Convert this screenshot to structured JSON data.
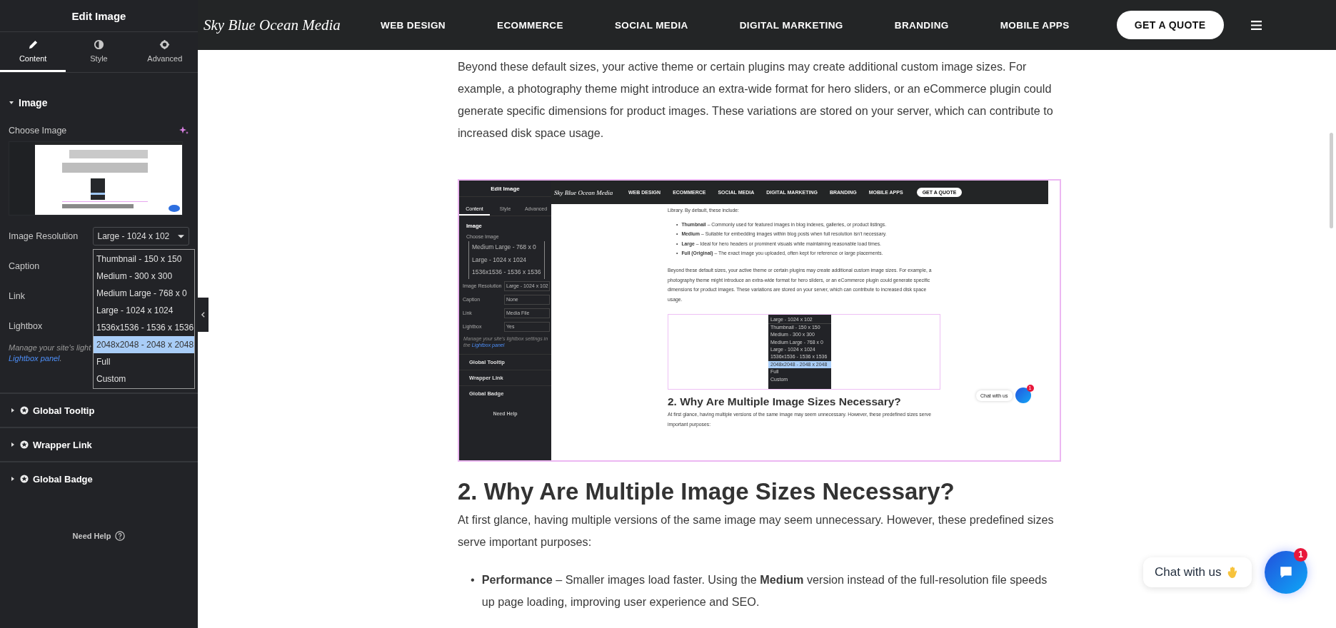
{
  "panel": {
    "title": "Edit Image",
    "tabs": [
      {
        "label": "Content",
        "selected": true
      },
      {
        "label": "Style",
        "selected": false
      },
      {
        "label": "Advanced",
        "selected": false
      }
    ],
    "section": {
      "title": "Image",
      "expanded": true
    },
    "choose_image": "Choose Image",
    "fields": [
      {
        "label": "Image Resolution",
        "value": "Large - 1024 x 102"
      },
      {
        "label": "Caption"
      },
      {
        "label": "Link"
      },
      {
        "label": "Lightbox"
      }
    ],
    "dropdown": [
      {
        "label": "Thumbnail - 150 x 150",
        "selected": false
      },
      {
        "label": "Medium - 300 x 300",
        "selected": false
      },
      {
        "label": "Medium Large - 768 x 0",
        "selected": false
      },
      {
        "label": "Large - 1024 x 1024",
        "selected": false
      },
      {
        "label": "1536x1536 - 1536 x 1536",
        "selected": false
      },
      {
        "label": "2048x2048 - 2048 x 2048",
        "selected": true
      },
      {
        "label": "Full",
        "selected": false
      },
      {
        "label": "Custom",
        "selected": false
      }
    ],
    "help": {
      "text": "Manage your site's light",
      "link": "Lightbox panel",
      "after": "."
    },
    "groups": [
      {
        "title": "Global Tooltip",
        "expanded": false
      },
      {
        "title": "Wrapper Link",
        "expanded": false
      },
      {
        "title": "Global Badge",
        "expanded": false
      }
    ],
    "need_help": "Need Help"
  },
  "navbar": {
    "logo": "Sky Blue Ocean Media",
    "links": [
      "WEB DESIGN",
      "ECOMMERCE",
      "SOCIAL MEDIA",
      "DIGITAL MARKETING",
      "BRANDING",
      "MOBILE APPS"
    ],
    "cta": "GET A QUOTE"
  },
  "article": {
    "intro": "Beyond these default sizes, your active theme or certain plugins may create additional custom image sizes. For example, a photography theme might introduce an extra-wide format for hero sliders, or an eCommerce plugin could generate specific dimensions for product images. These variations are stored on your server, which can contribute to increased disk space usage.",
    "heading": "2. Why Are Multiple Image Sizes Necessary?",
    "paragraph": "At first glance, having multiple versions of the same image may seem unnecessary. However, these predefined sizes serve important purposes:",
    "bullets": [
      {
        "marker": "•",
        "text": "**Performance** – Smaller images load faster. Using the **Medium** version instead of the full-resolution file speeds up page loading, improving user experience and SEO."
      }
    ]
  },
  "screenshot": {
    "panel": {
      "title": "Edit Image",
      "tabs": [
        {
          "label": "Content",
          "selected": true
        },
        {
          "label": "Style",
          "selected": false
        },
        {
          "label": "Advanced",
          "selected": false
        }
      ],
      "section": "Image",
      "choose_image": "Choose Image",
      "overlay_options": [
        "Medium Large - 768 x 0",
        "Large - 1024 x 1024",
        "1536x1536 - 1536 x 1536"
      ],
      "fields": [
        {
          "label": "Image Resolution",
          "value": "Large - 1024 x 102"
        },
        {
          "label": "Caption",
          "value": "None"
        },
        {
          "label": "Link",
          "value": "Media File"
        },
        {
          "label": "Lightbox",
          "value": "Yes"
        }
      ],
      "help": {
        "text": "Manage your site's lightbox settings in the",
        "link": "Lightbox panel"
      },
      "groups": [
        "Global Tooltip",
        "Wrapper Link",
        "Global Badge"
      ],
      "need_help": "Need Help"
    },
    "navbar": {
      "logo": "Sky Blue Ocean Media",
      "links": [
        "WEB DESIGN",
        "ECOMMERCE",
        "SOCIAL MEDIA",
        "DIGITAL MARKETING",
        "BRANDING",
        "MOBILE APPS"
      ],
      "cta": "GET A QUOTE"
    },
    "intro": "Library. By default, these include:",
    "bullets": [
      {
        "marker": "•",
        "text": "**Thumbnail** – Commonly used for featured images in blog indexes, galleries, or product listings."
      },
      {
        "marker": "•",
        "text": "**Medium** – Suitable for embedding images within blog posts when full resolution isn't necessary."
      },
      {
        "marker": "•",
        "text": "**Large** – Ideal for hero headers or prominent visuals while maintaining reasonable load times."
      },
      {
        "marker": "•",
        "text": "**Full (Original)** – The exact image you uploaded, often kept for reference or large placements."
      }
    ],
    "paragraph": "Beyond these default sizes, your active theme or certain plugins may create additional custom image sizes. For example, a photography theme might introduce an extra-wide format for hero sliders, or an eCommerce plugin could generate specific dimensions for product images. These variations are stored on your server, which can contribute to increased disk space usage.",
    "dropdown": {
      "value": "Large - 1024 x 102",
      "options": [
        {
          "label": "Thumbnail - 150 x 150",
          "selected": false
        },
        {
          "label": "Medium - 300 x 300",
          "selected": false
        },
        {
          "label": "Medium Large - 768 x 0",
          "selected": false
        },
        {
          "label": "Large - 1024 x 1024",
          "selected": false
        },
        {
          "label": "1536x1536 - 1536 x 1536",
          "selected": false
        },
        {
          "label": "2048x2048 - 2048 x 2048",
          "selected": true
        },
        {
          "label": "Full",
          "selected": false
        },
        {
          "label": "Custom",
          "selected": false
        }
      ]
    },
    "heading": "2. Why Are Multiple Image Sizes Necessary?",
    "paragraph2": "At first glance, having multiple versions of the same image may seem unnecessary. However, these predefined sizes serve important purposes:",
    "chat": {
      "label": "Chat with us",
      "badge": "1"
    }
  },
  "chat": {
    "label": "Chat with us",
    "badge": "1"
  }
}
